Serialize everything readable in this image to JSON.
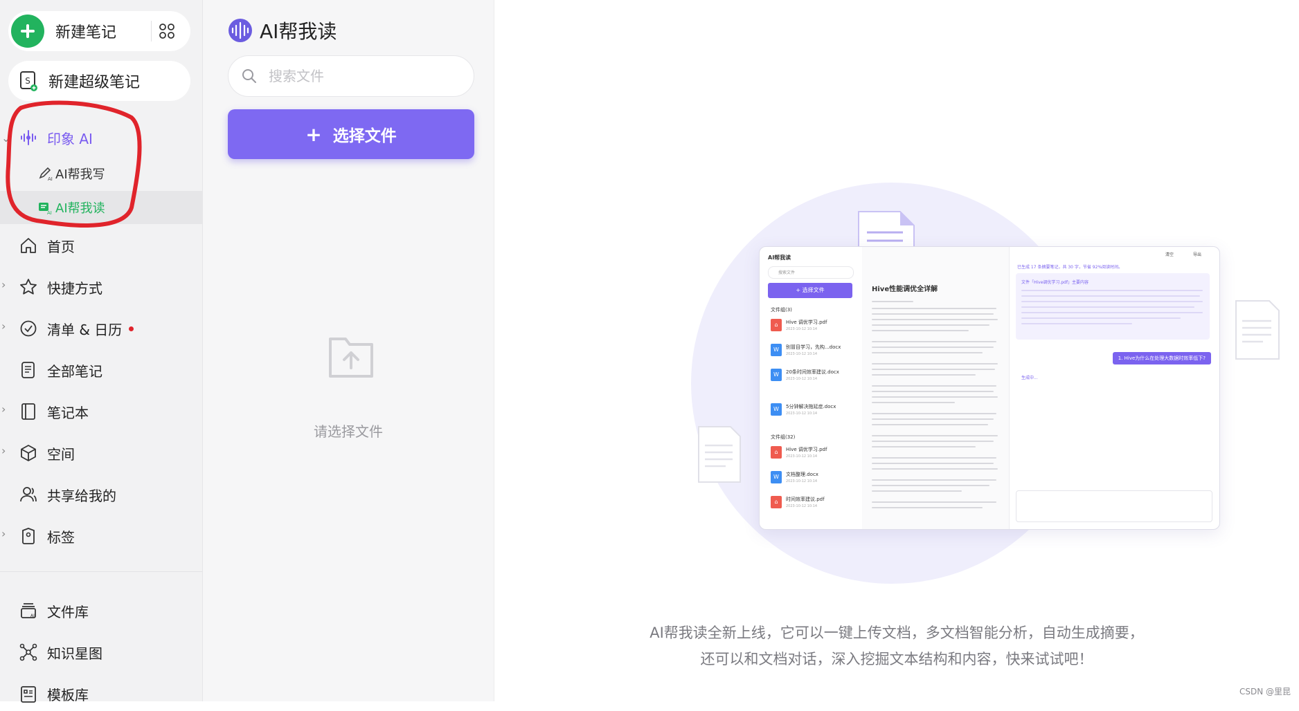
{
  "sidebar": {
    "new_note": "新建笔记",
    "new_super_note": "新建超级笔记",
    "ai_section": "印象 AI",
    "ai_write": "AI帮我写",
    "ai_read": "AI帮我读",
    "items": [
      {
        "label": "首页",
        "icon": "home-icon"
      },
      {
        "label": "快捷方式",
        "icon": "star-icon"
      },
      {
        "label": "清单 & 日历",
        "icon": "check-circle-icon"
      },
      {
        "label": "全部笔记",
        "icon": "notes-icon"
      },
      {
        "label": "笔记本",
        "icon": "notebook-icon"
      },
      {
        "label": "空间",
        "icon": "cube-icon"
      },
      {
        "label": "共享给我的",
        "icon": "shared-user-icon"
      },
      {
        "label": "标签",
        "icon": "tag-icon"
      }
    ],
    "bottom_items": [
      {
        "label": "文件库",
        "icon": "file-library-icon"
      },
      {
        "label": "知识星图",
        "icon": "knowledge-graph-icon"
      },
      {
        "label": "模板库",
        "icon": "template-icon"
      }
    ]
  },
  "panel": {
    "title": "AI帮我读",
    "search_placeholder": "搜索文件",
    "choose_file": "选择文件",
    "empty_text": "请选择文件"
  },
  "preview": {
    "app_title": "AI帮我读",
    "search": "搜索文件",
    "choose_file": "+ 选择文件",
    "doc_title": "Hive性能调优全详解",
    "group1": "文件组(3)",
    "group2": "文件组(32)",
    "files": [
      {
        "name": "Hive 调优学习.pdf",
        "type": "pdf",
        "date": "2023-10-12 10:14"
      },
      {
        "name": "别冒目学习，先构...docx",
        "type": "doc",
        "date": "2023-10-12 10:14"
      },
      {
        "name": "20条时间效率建议.docx",
        "type": "doc",
        "date": "2023-10-12 10:14"
      },
      {
        "name": "5分钟解决拖延症.docx",
        "type": "doc",
        "date": "2023-10-12 10:14"
      },
      {
        "name": "Hive 调优学习.pdf",
        "type": "pdf",
        "date": "2023-10-12 10:14"
      },
      {
        "name": "文档整理.docx",
        "type": "doc",
        "date": "2023-10-12 10:14"
      },
      {
        "name": "时间效率建议.pdf",
        "type": "pdf",
        "date": "2023-10-12 10:14"
      }
    ],
    "summary_header": "已生成 17 条摘要笔记，共 30 字，节省 92%阅读时间。",
    "summary_title": "文件「Hive调优学习.pdf」主要内容",
    "question": "1. Hive为什么在处理大数据时效率低下?",
    "generating": "生成中...",
    "clear": "清空",
    "export": "导出"
  },
  "intro": {
    "line1": "AI帮我读全新上线，它可以一键上传文档，多文档智能分析，自动生成摘要，",
    "line2": "还可以和文档对话，深入挖掘文本结构和内容，快来试试吧！"
  },
  "watermark": "CSDN @里昆",
  "colors": {
    "accent_purple": "#7e69f2",
    "green": "#22b35e",
    "annotation_red": "#e0242b"
  }
}
